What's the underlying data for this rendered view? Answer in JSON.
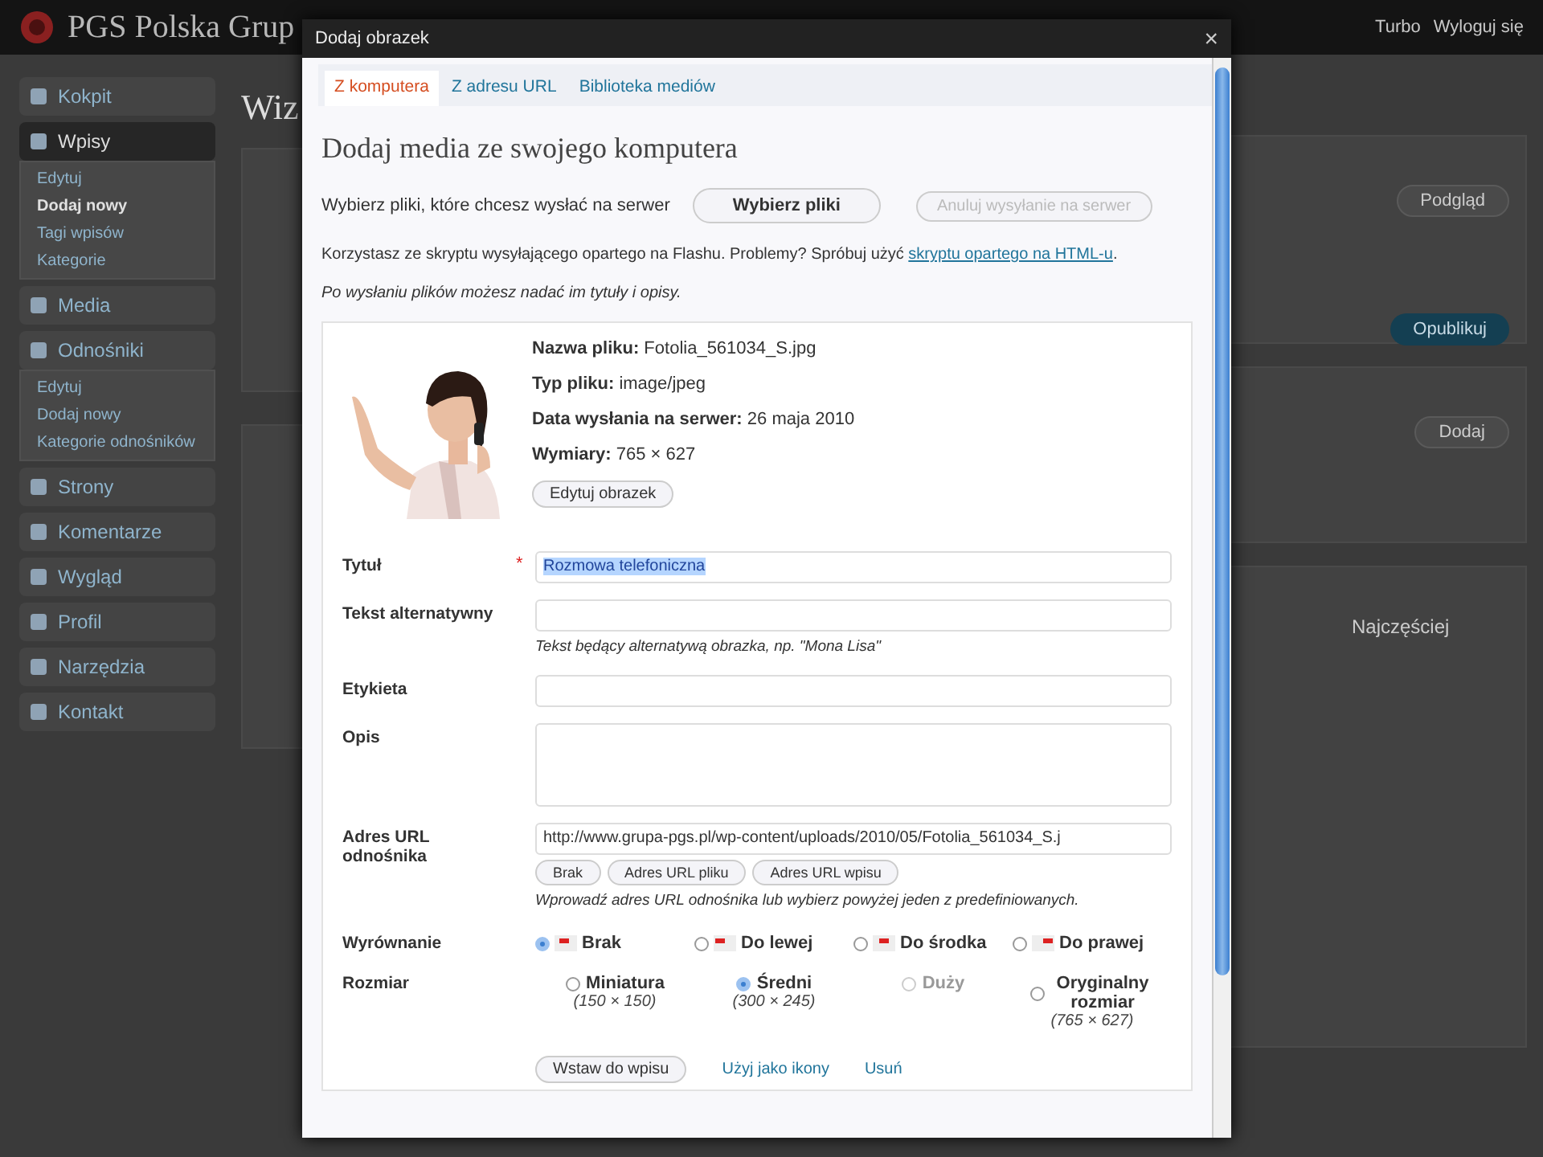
{
  "admin_bar": {
    "site_title": "PGS Polska Grup",
    "links": [
      "Turbo",
      "Wyloguj się"
    ]
  },
  "sidebar": {
    "items": [
      {
        "label": "Kokpit",
        "selected": false
      },
      {
        "label": "Wpisy",
        "selected": true,
        "children": [
          {
            "label": "Edytuj",
            "selected": false
          },
          {
            "label": "Dodaj nowy",
            "selected": true
          },
          {
            "label": "Tagi wpisów",
            "selected": false
          },
          {
            "label": "Kategorie",
            "selected": false
          }
        ]
      },
      {
        "label": "Media",
        "selected": false
      },
      {
        "label": "Odnośniki",
        "selected": false,
        "children": [
          {
            "label": "Edytuj",
            "selected": false
          },
          {
            "label": "Dodaj nowy",
            "selected": false
          },
          {
            "label": "Kategorie odnośników",
            "selected": false
          }
        ]
      },
      {
        "label": "Strony",
        "selected": false
      },
      {
        "label": "Komentarze",
        "selected": false
      },
      {
        "label": "Wygląd",
        "selected": false
      },
      {
        "label": "Profil",
        "selected": false
      },
      {
        "label": "Narzędzia",
        "selected": false
      },
      {
        "label": "Kontakt",
        "selected": false
      }
    ]
  },
  "editor": {
    "page_title": "Wiz",
    "preview_button": "Podgląd",
    "publish_button": "Opublikuj",
    "tag_button": "Dodaj",
    "category_tab": "Najczęściej"
  },
  "dialog": {
    "title": "Dodaj obrazek",
    "close": "×",
    "tabs": [
      {
        "label": "Z komputera",
        "selected": true
      },
      {
        "label": "Z adresu URL",
        "selected": false
      },
      {
        "label": "Biblioteka mediów",
        "selected": false
      }
    ],
    "heading": "Dodaj media ze swojego komputera",
    "choose_label": "Wybierz pliki, które chcesz wysłać na serwer",
    "choose_button": "Wybierz pliki",
    "cancel_button": {
      "label": "Anuluj wysyłanie na serwer",
      "disabled": true
    },
    "flash_note": "Korzystasz ze skryptu wysyłającego opartego na Flashu. Problemy? Spróbuj użyć",
    "flash_link": "skryptu opartego na HTML-u",
    "flash_end": ".",
    "after_note": "Po wysłaniu plików możesz nadać im tytuły i opisy.",
    "file": {
      "kind": "picture",
      "meta": [
        {
          "label": "Nazwa pliku:",
          "value": "Fotolia_561034_S.jpg"
        },
        {
          "label": "Typ pliku:",
          "value": "image/jpeg"
        },
        {
          "label": "Data wysłania na serwer:",
          "value": "26 maja 2010"
        },
        {
          "label": "Wymiary:",
          "value": "765 × 627"
        }
      ],
      "edit_button": "Edytuj obrazek"
    },
    "fields": [
      {
        "kind": "text",
        "label": "Tytuł",
        "required": true,
        "value": "Rozmowa telefoniczna"
      },
      {
        "kind": "text",
        "label": "Tekst alternatywny",
        "required": false,
        "help": "Tekst będący alternatywą obrazka, np. \"Mona Lisa\""
      },
      {
        "kind": "text",
        "label": "Etykieta",
        "required": false
      },
      {
        "kind": "textarea",
        "label": "Opis",
        "required": false
      },
      {
        "kind": "url",
        "label": "Adres URL odnośnika",
        "required": false,
        "value": "http://www.grupa-pgs.pl/wp-content/uploads/2010/05/Fotolia_561034_S.j",
        "buttons": [
          "Brak",
          "Adres URL pliku",
          "Adres URL wpisu"
        ],
        "help": "Wprowadź adres URL odnośnika lub wybierz powyżej jeden z predefiniowanych."
      }
    ],
    "required_mark": "*",
    "alignment": {
      "label": "Wyrównanie",
      "options": [
        {
          "label": "Brak",
          "selected": true
        },
        {
          "label": "Do lewej",
          "selected": false
        },
        {
          "label": "Do środka",
          "selected": false
        },
        {
          "label": "Do prawej",
          "selected": false
        }
      ]
    },
    "size": {
      "label": "Rozmiar",
      "options": [
        {
          "label": "Miniatura",
          "dims": "(150 × 150)",
          "selected": false,
          "disabled": false
        },
        {
          "label": "Średni",
          "dims": "(300 × 245)",
          "selected": true,
          "disabled": false
        },
        {
          "label": "Duży",
          "selected": false,
          "disabled": true
        },
        {
          "label": "Oryginalny rozmiar",
          "dims": "(765 × 627)",
          "selected": false,
          "disabled": false
        }
      ]
    },
    "insert_button": "Wstaw do wpisu",
    "thumb_link": "Użyj jako ikony",
    "delete_link": "Usuń"
  }
}
